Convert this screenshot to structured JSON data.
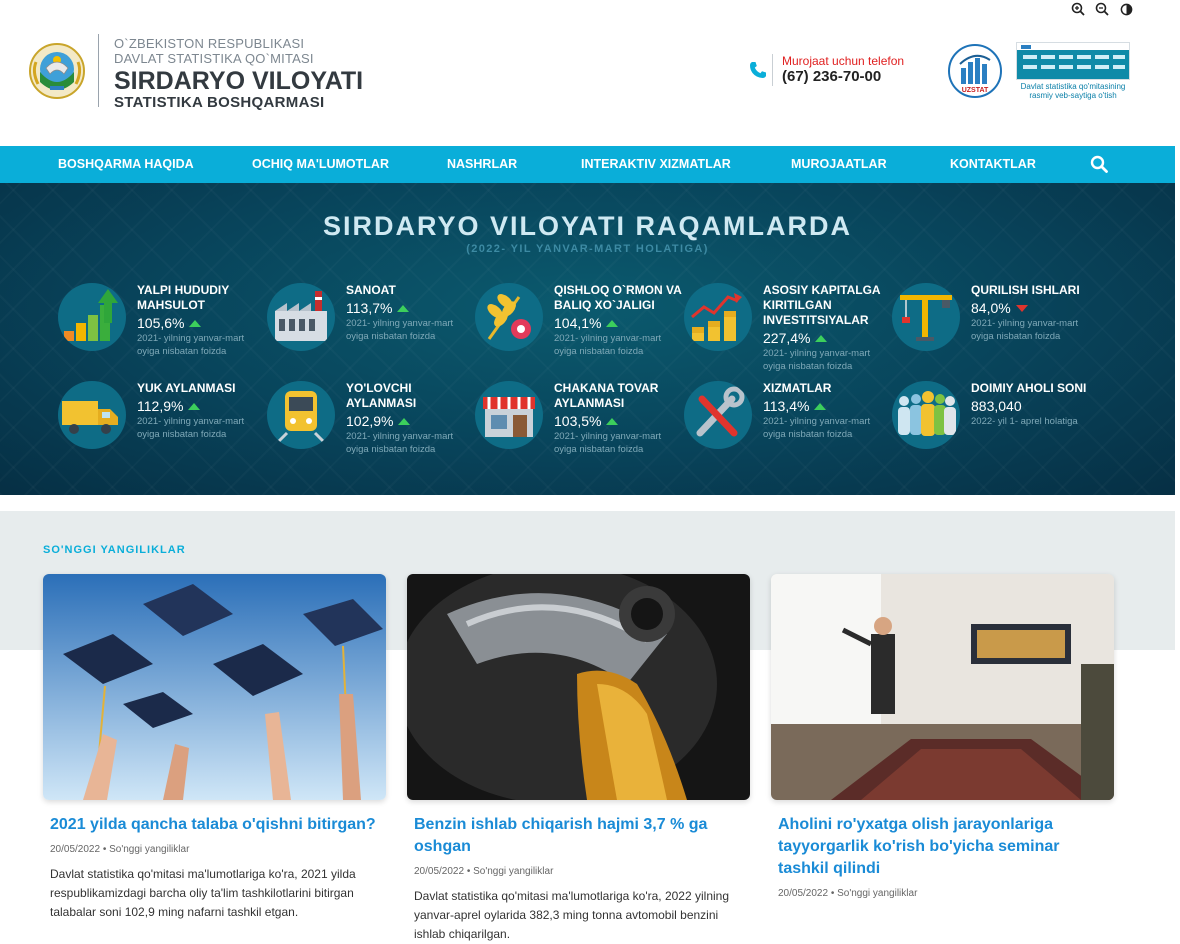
{
  "header": {
    "org_line1": "O`ZBEKISTON RESPUBLIKASI",
    "org_line2": "DAVLAT STATISTIKA QO`MITASI",
    "org_title": "SIRDARYO VILOYATI",
    "org_subtitle": "STATISTIKA BOSHQARMASI",
    "phone_label": "Murojaat uchun telefon",
    "phone_number": "(67) 236-70-00",
    "uzstat_label": "UZSTAT",
    "site_link_caption": "Davlat statistika qo'mitasining rasmiy veb-saytiga o'tish"
  },
  "nav": {
    "items": [
      "BOSHQARMA HAQIDA",
      "OCHIQ MA'LUMOTLAR",
      "NASHRLAR",
      "INTERAKTIV XIZMATLAR",
      "MUROJAATLAR",
      "KONTAKTLAR"
    ]
  },
  "banner": {
    "title": "SIRDARYO VILOYATI RAQAMLARDA",
    "subtitle": "(2022- YIL YANVAR-MART HOLATIGA)",
    "stats": [
      {
        "name": "YALPI HUDUDIY MAHSULOT",
        "value": "105,6%",
        "trend": "up",
        "note": "2021- yilning yanvar-mart oyiga nisbatan foizda",
        "icon": "bar-growth-icon"
      },
      {
        "name": "SANOAT",
        "value": "113,7%",
        "trend": "up",
        "note": "2021- yilning yanvar-mart oyiga nisbatan foizda",
        "icon": "factory-icon"
      },
      {
        "name": "QISHLOQ O`RMON VA BALIQ XO`JALIGI",
        "value": "104,1%",
        "trend": "up",
        "note": "2021- yilning yanvar-mart oyiga nisbatan foizda",
        "icon": "wheat-gear-icon"
      },
      {
        "name": "ASOSIY KAPITALGA KIRITILGAN INVESTITSIYALAR",
        "value": "227,4%",
        "trend": "up",
        "note": "2021- yilning yanvar-mart oyiga nisbatan foizda",
        "icon": "coins-chart-icon"
      },
      {
        "name": "QURILISH ISHLARI",
        "value": "84,0%",
        "trend": "down",
        "note": "2021- yilning yanvar-mart oyiga nisbatan foizda",
        "icon": "crane-icon"
      },
      {
        "name": "YUK AYLANMASI",
        "value": "112,9%",
        "trend": "up",
        "note": "2021- yilning yanvar-mart oyiga nisbatan foizda",
        "icon": "truck-icon"
      },
      {
        "name": "YO'LOVCHI AYLANMASI",
        "value": "102,9%",
        "trend": "up",
        "note": "2021- yilning yanvar-mart oyiga nisbatan foizda",
        "icon": "train-icon"
      },
      {
        "name": "CHAKANA TOVAR AYLANMASI",
        "value": "103,5%",
        "trend": "up",
        "note": "2021- yilning yanvar-mart oyiga nisbatan foizda",
        "icon": "shop-icon"
      },
      {
        "name": "XIZMATLAR",
        "value": "113,4%",
        "trend": "up",
        "note": "2021- yilning yanvar-mart oyiga nisbatan foizda",
        "icon": "tools-icon"
      },
      {
        "name": "DOIMIY AHOLI SONI",
        "value": "883,040",
        "trend": "none",
        "note": "2022- yil 1- aprel holatiga",
        "icon": "people-icon"
      }
    ]
  },
  "news": {
    "heading": "SO'NGGI YANGILIKLAR",
    "cards": [
      {
        "title": "2021 yilda qancha talaba o'qishni bitirgan?",
        "meta": "20/05/2022 • So'nggi yangiliklar",
        "excerpt": "Davlat statistika qo'mitasi ma'lumotlariga ko'ra, 2021 yilda respublikamizdagi barcha oliy ta'lim tashkilotlarini bitirgan talabalar soni 102,9 ming nafarni tashkil etgan.",
        "image": "graduation-caps-photo"
      },
      {
        "title": "Benzin ishlab chiqarish hajmi 3,7 % ga oshgan",
        "meta": "20/05/2022 • So'nggi yangiliklar",
        "excerpt": "Davlat statistika qo'mitasi ma'lumotlariga ko'ra, 2022 yilning yanvar-aprel oylarida 382,3 ming tonna avtomobil benzini ishlab chiqarilgan.",
        "image": "fuel-nozzle-photo"
      },
      {
        "title": "Aholini ro'yxatga olish jarayonlariga tayyorgarlik ko'rish bo'yicha seminar tashkil qilindi",
        "meta": "20/05/2022 • So'nggi yangiliklar",
        "excerpt": "",
        "image": "seminar-presentation-photo"
      }
    ]
  },
  "colors": {
    "nav_bg": "#0aaed9",
    "banner_bg": "#08435a",
    "link": "#1a8bd6",
    "trend_up": "#3ccf5c",
    "trend_down": "#e0342d",
    "phone_label": "#e02020"
  }
}
